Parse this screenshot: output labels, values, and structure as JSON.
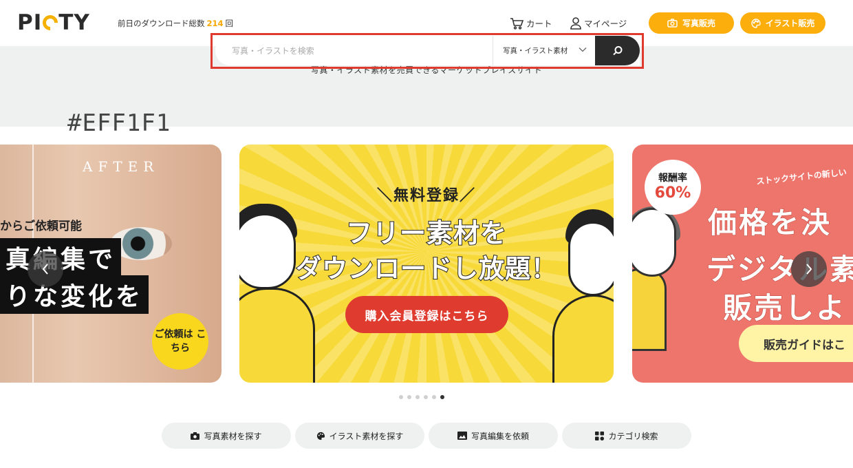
{
  "header": {
    "logo": "PICTY",
    "download_prefix": "前日のダウンロード総数",
    "download_count": "214",
    "download_suffix": "回",
    "cart_label": "カート",
    "mypage_label": "マイページ",
    "photo_sell_label": "写真販売",
    "illust_sell_label": "イラスト販売"
  },
  "search": {
    "tagline": "写真・イラスト素材を売買できるマーケットプレイスサイト",
    "placeholder": "写真・イラストを検索",
    "category_selected": "写真・イラスト素材",
    "highlight_color": "#E03A2E"
  },
  "annotation": {
    "color_note": "#EFF1F1"
  },
  "carousel": {
    "slide_left": {
      "after_text": "AFTER",
      "tagline": "からご依頼可能",
      "headline_1": "真編集で",
      "headline_2": "りな変化を",
      "request_label": "ご依頼は こちら"
    },
    "slide_center": {
      "kicker": "＼無料登録／",
      "headline_1": "フリー素材を",
      "headline_2": "ダウンロードし放題！",
      "cta_label": "購入会員登録はこちら"
    },
    "slide_right": {
      "bubble_1": "報酬率",
      "bubble_2": "60%",
      "ribbon": "ストックサイトの新しい",
      "headline_1": "価格を決",
      "headline_2": "デジタル素",
      "headline_3": "販売しよ",
      "guide_label": "販売ガイドはこ"
    },
    "dot_count": 6,
    "active_dot": 6
  },
  "quick_links": [
    {
      "label": "写真素材を探す",
      "icon": "camera-icon"
    },
    {
      "label": "イラスト素材を探す",
      "icon": "palette-icon"
    },
    {
      "label": "写真編集を依頼",
      "icon": "image-icon"
    },
    {
      "label": "カテゴリ検索",
      "icon": "grid-icon"
    }
  ],
  "colors": {
    "accent": "#FCAE0C",
    "search_band": "#EFF1F1",
    "cta_red": "#DF3B2F",
    "dark": "#2B2B2B"
  }
}
